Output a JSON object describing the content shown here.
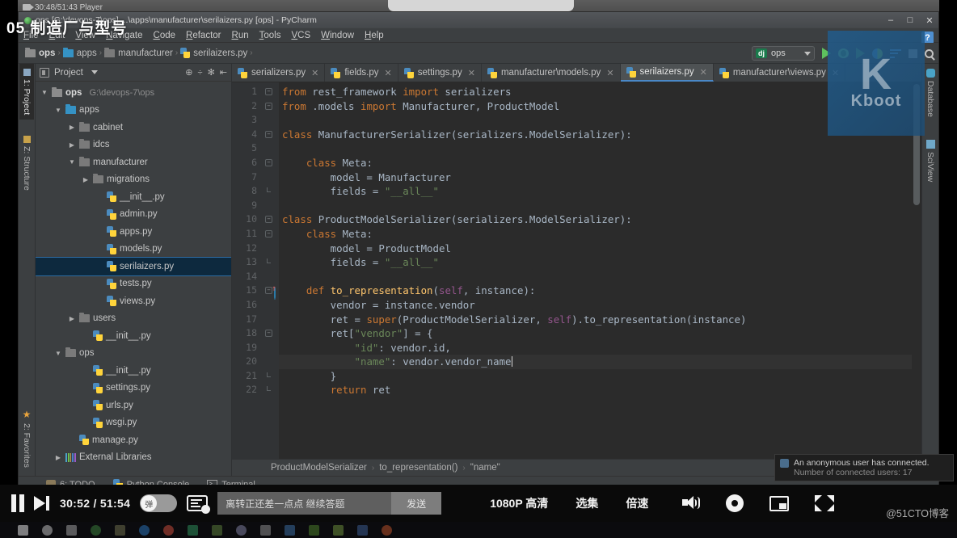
{
  "player": {
    "topbar_label": "30:48/51:43 Player",
    "overlay_title": "05 制造厂与型号",
    "time": "30:52 / 51:54",
    "toggle_label": "弹",
    "comment_value": "离转正还差一点点 继续答题",
    "send_label": "发送",
    "quality_label": "1080P 高清",
    "episodes_label": "选集",
    "speed_label": "倍速",
    "watermark": "@51CTO博客",
    "icons": {
      "pause": "pause-icon",
      "next": "next-episode-icon",
      "danmaku_toggle": "danmaku-toggle",
      "danmaku_settings": "danmaku-settings-icon",
      "volume": "volume-icon",
      "settings": "gear-icon",
      "pip": "picture-in-picture-icon",
      "fullscreen": "fullscreen-icon"
    }
  },
  "window": {
    "title": "ops [G:\\devops-7\\ops] ...\\apps\\manufacturer\\serilaizers.py [ops] - PyCharm",
    "controls": {
      "minimize": "–",
      "maximize": "□",
      "close": "✕"
    },
    "help_badge": "?"
  },
  "menubar": {
    "items": [
      "File",
      "Edit",
      "View",
      "Navigate",
      "Code",
      "Refactor",
      "Run",
      "Tools",
      "VCS",
      "Window",
      "Help"
    ]
  },
  "navbar": {
    "crumbs": [
      {
        "label": "ops",
        "icon": "folder-icon",
        "bold": true
      },
      {
        "label": "apps",
        "icon": "folder-blue-icon",
        "bold": false
      },
      {
        "label": "manufacturer",
        "icon": "folder-module-icon",
        "bold": false
      },
      {
        "label": "serilaizers.py",
        "icon": "python-file-icon",
        "bold": false
      }
    ],
    "run_config": {
      "badge": "dj",
      "name": "ops"
    }
  },
  "project_panel": {
    "title": "Project",
    "tree": [
      {
        "label": "ops",
        "path": "G:\\devops-7\\ops",
        "indent": 0,
        "arrow": "open",
        "icon": "folder-icon",
        "bold": true,
        "selected": false
      },
      {
        "label": "apps",
        "path": "",
        "indent": 1,
        "arrow": "open",
        "icon": "folder-blue-icon",
        "bold": false,
        "selected": false
      },
      {
        "label": "cabinet",
        "path": "",
        "indent": 2,
        "arrow": "closed",
        "icon": "folder-module-icon",
        "bold": false,
        "selected": false
      },
      {
        "label": "idcs",
        "path": "",
        "indent": 2,
        "arrow": "closed",
        "icon": "folder-module-icon",
        "bold": false,
        "selected": false
      },
      {
        "label": "manufacturer",
        "path": "",
        "indent": 2,
        "arrow": "open",
        "icon": "folder-module-icon",
        "bold": false,
        "selected": false
      },
      {
        "label": "migrations",
        "path": "",
        "indent": 3,
        "arrow": "closed",
        "icon": "folder-module-icon",
        "bold": false,
        "selected": false
      },
      {
        "label": "__init__.py",
        "path": "",
        "indent": 4,
        "arrow": "none",
        "icon": "python-file-icon",
        "bold": false,
        "selected": false
      },
      {
        "label": "admin.py",
        "path": "",
        "indent": 4,
        "arrow": "none",
        "icon": "python-file-icon",
        "bold": false,
        "selected": false
      },
      {
        "label": "apps.py",
        "path": "",
        "indent": 4,
        "arrow": "none",
        "icon": "python-file-icon",
        "bold": false,
        "selected": false
      },
      {
        "label": "models.py",
        "path": "",
        "indent": 4,
        "arrow": "none",
        "icon": "python-file-icon",
        "bold": false,
        "selected": false
      },
      {
        "label": "serilaizers.py",
        "path": "",
        "indent": 4,
        "arrow": "none",
        "icon": "python-file-icon",
        "bold": false,
        "selected": true
      },
      {
        "label": "tests.py",
        "path": "",
        "indent": 4,
        "arrow": "none",
        "icon": "python-file-icon",
        "bold": false,
        "selected": false
      },
      {
        "label": "views.py",
        "path": "",
        "indent": 4,
        "arrow": "none",
        "icon": "python-file-icon",
        "bold": false,
        "selected": false
      },
      {
        "label": "users",
        "path": "",
        "indent": 2,
        "arrow": "closed",
        "icon": "folder-module-icon",
        "bold": false,
        "selected": false
      },
      {
        "label": "__init__.py",
        "path": "",
        "indent": 3,
        "arrow": "none",
        "icon": "python-file-icon",
        "bold": false,
        "selected": false
      },
      {
        "label": "ops",
        "path": "",
        "indent": 1,
        "arrow": "open",
        "icon": "folder-module-icon",
        "bold": false,
        "selected": false
      },
      {
        "label": "__init__.py",
        "path": "",
        "indent": 3,
        "arrow": "none",
        "icon": "python-file-icon",
        "bold": false,
        "selected": false
      },
      {
        "label": "settings.py",
        "path": "",
        "indent": 3,
        "arrow": "none",
        "icon": "python-file-icon",
        "bold": false,
        "selected": false
      },
      {
        "label": "urls.py",
        "path": "",
        "indent": 3,
        "arrow": "none",
        "icon": "python-file-icon",
        "bold": false,
        "selected": false
      },
      {
        "label": "wsgi.py",
        "path": "",
        "indent": 3,
        "arrow": "none",
        "icon": "python-file-icon",
        "bold": false,
        "selected": false
      },
      {
        "label": "manage.py",
        "path": "",
        "indent": 2,
        "arrow": "none",
        "icon": "python-file-icon",
        "bold": false,
        "selected": false
      },
      {
        "label": "External Libraries",
        "path": "",
        "indent": 1,
        "arrow": "closed",
        "icon": "library-icon",
        "bold": false,
        "selected": false
      }
    ]
  },
  "left_strip": {
    "tabs": [
      "1: Project",
      "Z: Structure",
      "2: Favorites"
    ]
  },
  "right_strip": {
    "tabs": [
      "Database",
      "SciView"
    ]
  },
  "editor": {
    "tabs": [
      {
        "label": "serializers.py",
        "active": false
      },
      {
        "label": "fields.py",
        "active": false
      },
      {
        "label": "settings.py",
        "active": false
      },
      {
        "label": "manufacturer\\models.py",
        "active": false
      },
      {
        "label": "serilaizers.py",
        "active": true
      },
      {
        "label": "manufacturer\\views.py",
        "active": false
      }
    ],
    "line_numbers": [
      "1",
      "2",
      "3",
      "4",
      "5",
      "6",
      "7",
      "8",
      "9",
      "10",
      "11",
      "12",
      "13",
      "14",
      "15",
      "16",
      "17",
      "18",
      "19",
      "20",
      "21",
      "22"
    ],
    "code": [
      "from rest_framework import serializers",
      "from .models import Manufacturer, ProductModel",
      "",
      "class ManufacturerSerializer(serializers.ModelSerializer):",
      "",
      "    class Meta:",
      "        model = Manufacturer",
      "        fields = \"__all__\"",
      "",
      "class ProductModelSerializer(serializers.ModelSerializer):",
      "    class Meta:",
      "        model = ProductModel",
      "        fields = \"__all__\"",
      "",
      "    def to_representation(self, instance):",
      "        vendor = instance.vendor",
      "        ret = super(ProductModelSerializer, self).to_representation(instance)",
      "        ret[\"vendor\"] = {",
      "            \"id\": vendor.id,",
      "            \"name\": vendor.vendor_name",
      "        }",
      "        return ret"
    ],
    "current_line": 20,
    "breadcrumbs": [
      "ProductModelSerializer",
      "to_representation()",
      "\"name\""
    ]
  },
  "statusbar": {
    "items": [
      {
        "label": "6: TODO",
        "icon": "todo-icon"
      },
      {
        "label": "Python Console",
        "icon": "python-icon"
      },
      {
        "label": "Terminal",
        "icon": "terminal-icon"
      }
    ]
  },
  "notification": {
    "title": "An anonymous user has connected.",
    "subtitle": "Number of connected users: 17"
  },
  "brand_overlay": {
    "letter": "K",
    "text": "Kboot"
  }
}
